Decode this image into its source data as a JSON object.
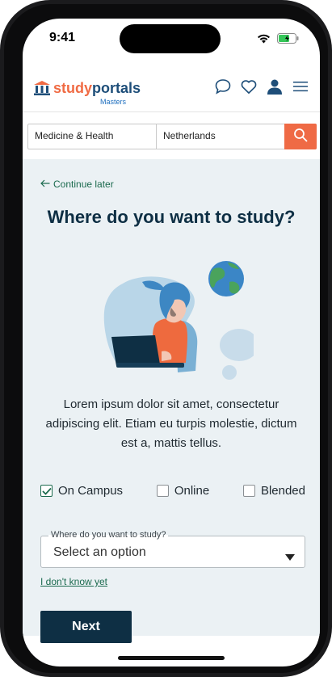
{
  "status_bar": {
    "time": "9:41"
  },
  "header": {
    "logo_part1": "study",
    "logo_part2": "portals",
    "logo_sub": "Masters",
    "icons": [
      "chat-icon",
      "heart-icon",
      "user-icon",
      "menu-icon"
    ]
  },
  "search": {
    "discipline": "Medicine & Health",
    "location": "Netherlands"
  },
  "main": {
    "continue_label": "Continue later",
    "title": "Where do you want to study?",
    "description": "Lorem ipsum dolor sit amet, consectetur adipiscing elit. Etiam eu turpis molestie, dictum est a, mattis tellus.",
    "options": [
      {
        "label": "On Campus",
        "checked": true
      },
      {
        "label": "Online",
        "checked": false
      },
      {
        "label": "Blended",
        "checked": false
      }
    ],
    "select": {
      "label": "Where do you want to study?",
      "value": "Select an option"
    },
    "dont_know": "I don't know yet",
    "next_label": "Next"
  },
  "colors": {
    "brand_orange": "#ef6a45",
    "navy": "#0e2f44",
    "green_link": "#1b6a4e",
    "panel_bg": "#ebf1f4"
  }
}
